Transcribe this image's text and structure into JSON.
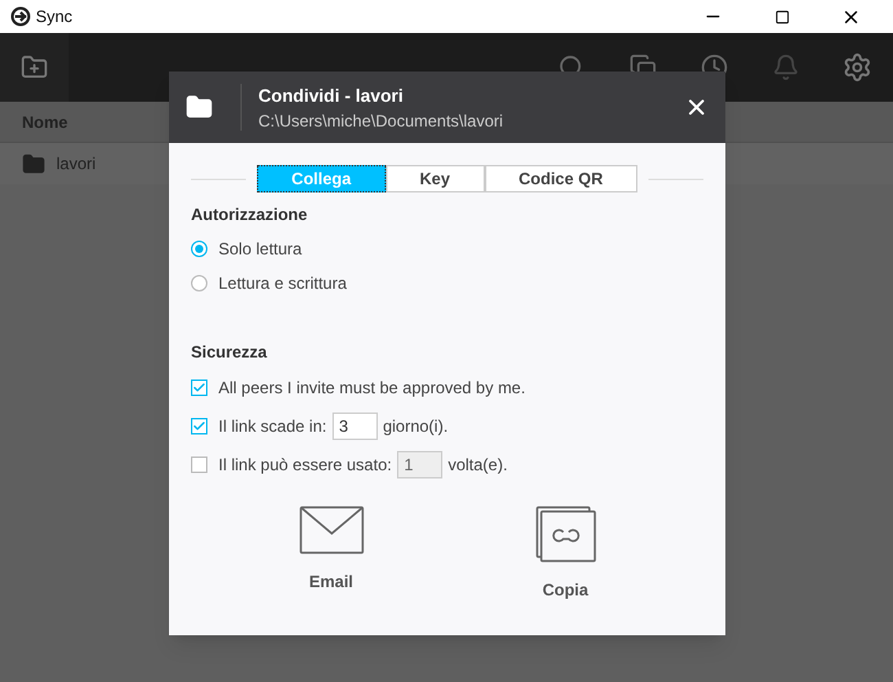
{
  "window": {
    "title": "Sync"
  },
  "file_list": {
    "column": "Nome",
    "rows": [
      {
        "name": "lavori"
      }
    ]
  },
  "dialog": {
    "title": "Condividi - lavori",
    "path": "C:\\Users\\miche\\Documents\\lavori",
    "tabs": [
      {
        "label": "Collega",
        "selected": true
      },
      {
        "label": "Key",
        "selected": false
      },
      {
        "label": "Codice QR",
        "selected": false
      }
    ],
    "authorization": {
      "heading": "Autorizzazione",
      "options": [
        {
          "label": "Solo lettura",
          "selected": true
        },
        {
          "label": "Lettura e scrittura",
          "selected": false
        }
      ]
    },
    "security": {
      "heading": "Sicurezza",
      "options": [
        {
          "kind": "plain",
          "label": "All peers I invite must be approved by me.",
          "checked": true
        },
        {
          "kind": "field",
          "label": "Il link scade in:",
          "value": "3",
          "unit": "giorno(i).",
          "checked": true,
          "disabled": false
        },
        {
          "kind": "field",
          "label": "Il link può essere usato:",
          "value": "1",
          "unit": "volta(e).",
          "checked": false,
          "disabled": true
        }
      ]
    },
    "actions": [
      {
        "kind": "email",
        "label": "Email"
      },
      {
        "kind": "copy",
        "label": "Copia"
      }
    ]
  }
}
